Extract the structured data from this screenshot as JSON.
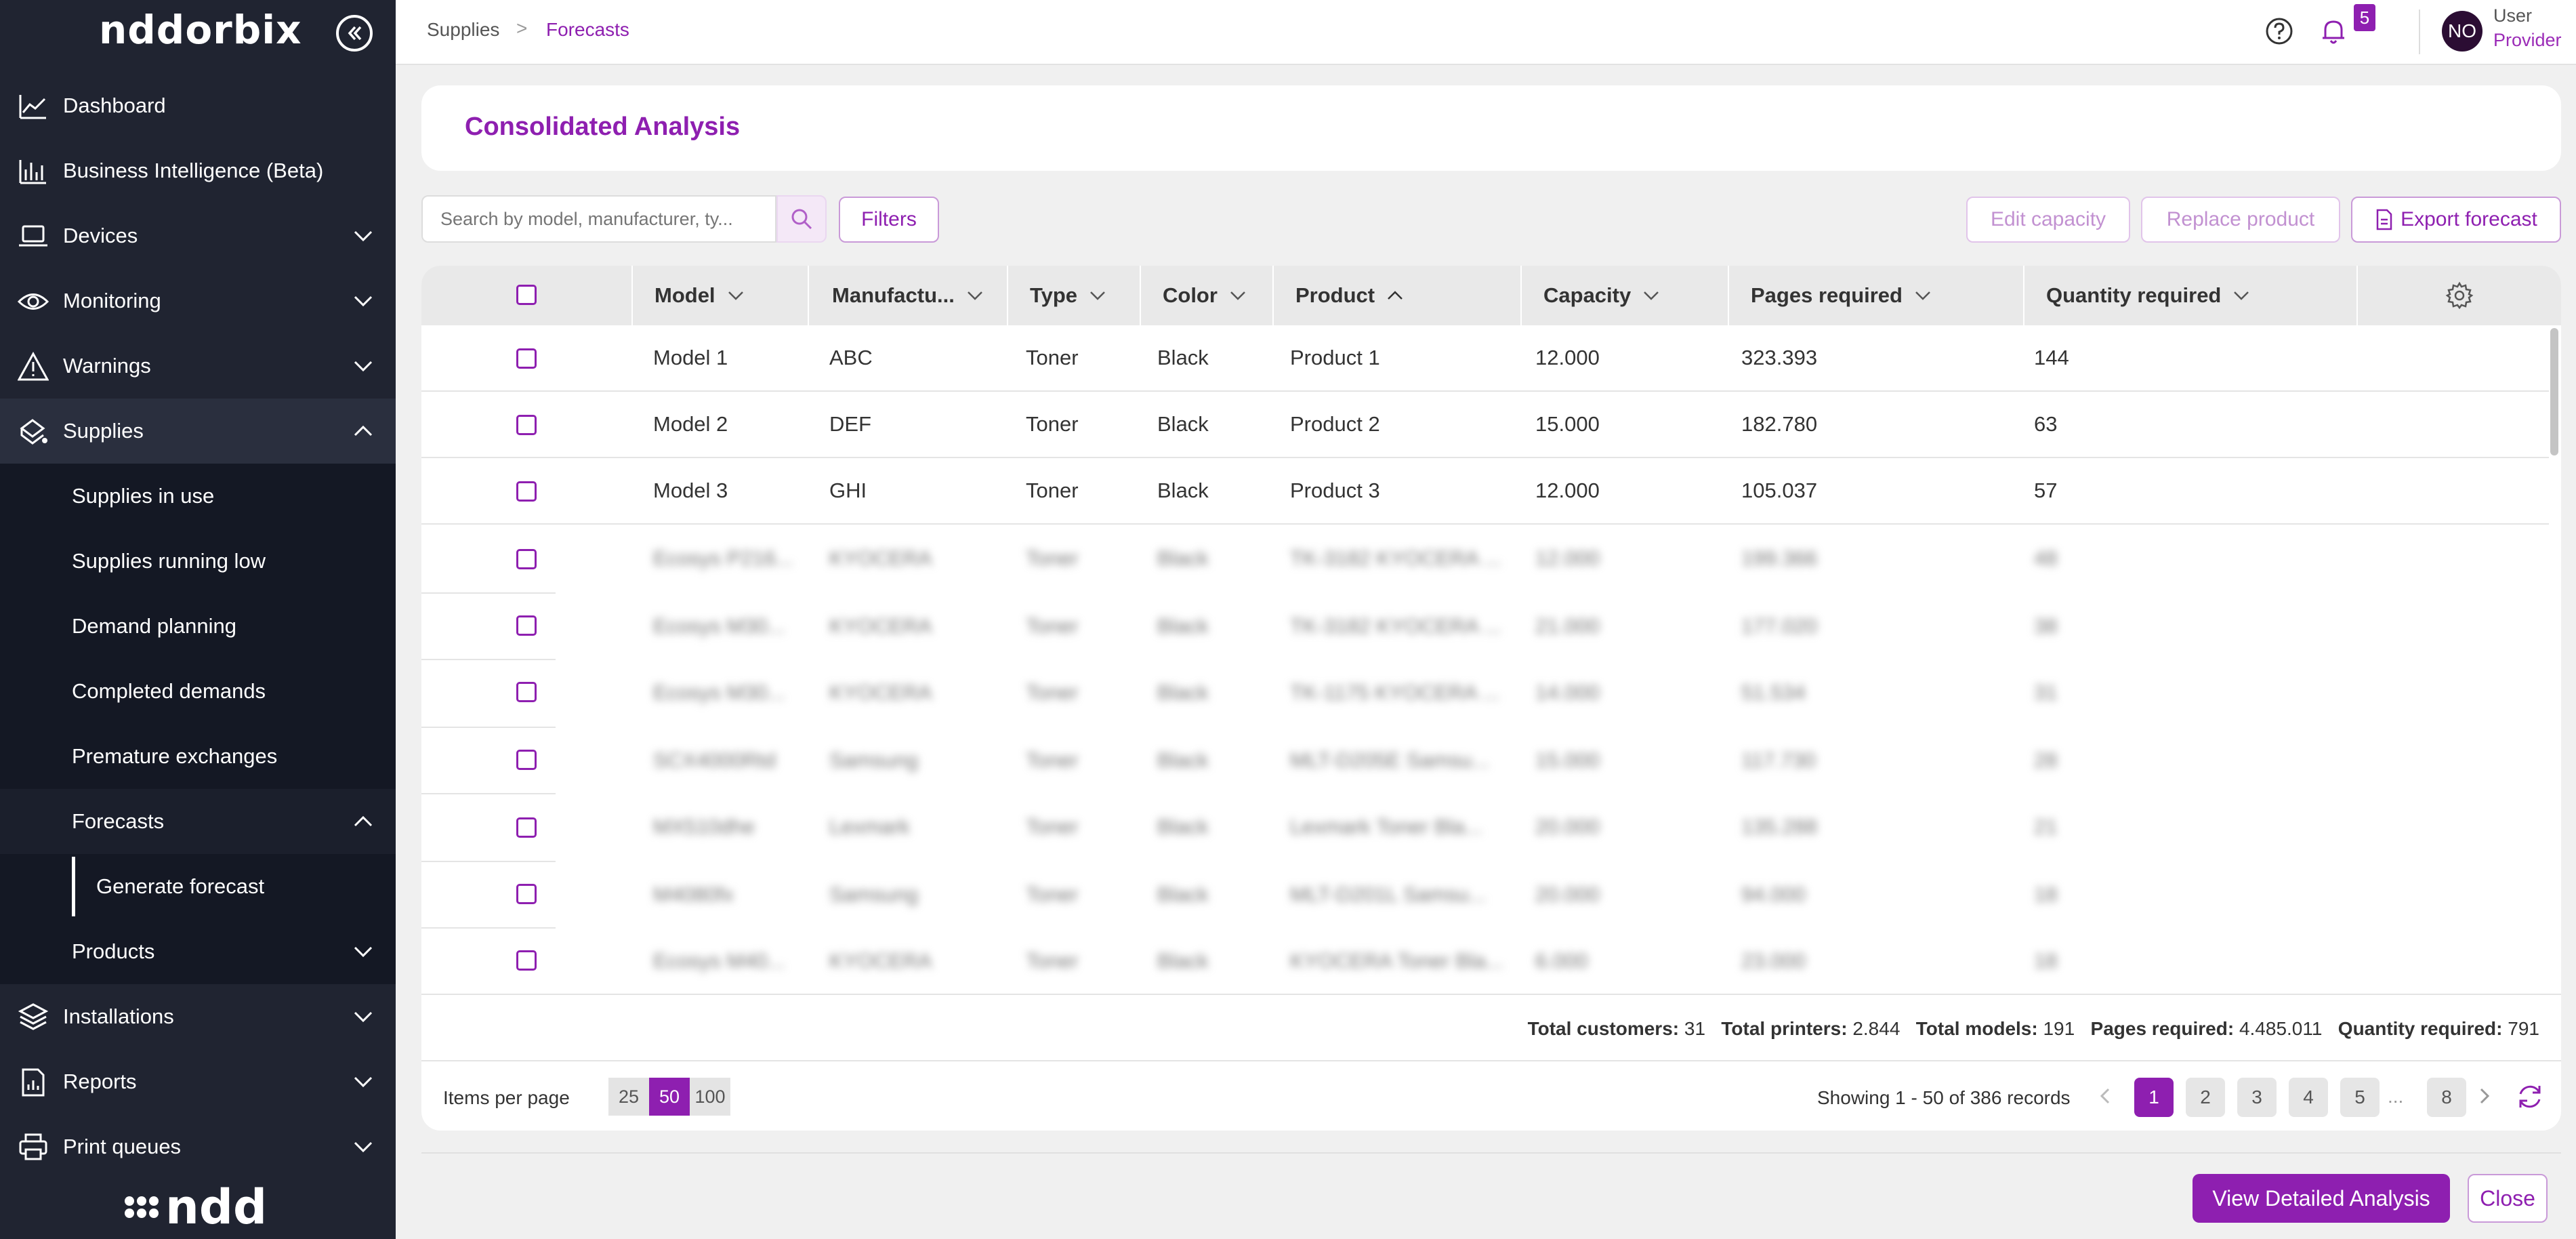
{
  "brand": {
    "logo": "nddorbix",
    "footer_logo": "ndd",
    "icon": "double-chevron-left-icon"
  },
  "sidebar": {
    "items": [
      {
        "label": "Dashboard",
        "icon": "trend-chart-icon"
      },
      {
        "label": "Business Intelligence (Beta)",
        "icon": "bar-chart-icon"
      },
      {
        "label": "Devices",
        "icon": "laptop-icon"
      },
      {
        "label": "Monitoring",
        "icon": "eye-icon"
      },
      {
        "label": "Warnings",
        "icon": "warning-icon"
      },
      {
        "label": "Supplies",
        "icon": "toner-icon"
      },
      {
        "label": "Installations",
        "icon": "layers-icon"
      },
      {
        "label": "Reports",
        "icon": "report-icon"
      },
      {
        "label": "Print queues",
        "icon": "printer-icon"
      }
    ],
    "supplies_sub": [
      {
        "label": "Supplies in use"
      },
      {
        "label": "Supplies running low"
      },
      {
        "label": "Demand planning"
      },
      {
        "label": "Completed demands"
      },
      {
        "label": "Premature exchanges"
      },
      {
        "label": "Forecasts"
      },
      {
        "label": "Products"
      }
    ],
    "forecasts_sub": [
      {
        "label": "Generate forecast"
      }
    ]
  },
  "header": {
    "breadcrumb": [
      "Supplies",
      "Forecasts"
    ],
    "breadcrumb_separator": ">",
    "notifications_count": "5",
    "avatar_initials": "NO",
    "user_name": "User",
    "user_role": "Provider"
  },
  "page": {
    "title": "Consolidated Analysis"
  },
  "toolbar": {
    "search_placeholder": "Search by model, manufacturer, ty...",
    "filters_label": "Filters",
    "edit_capacity_label": "Edit capacity",
    "replace_product_label": "Replace product",
    "export_forecast_label": "Export forecast"
  },
  "table": {
    "columns": [
      "Model",
      "Manufactu...",
      "Type",
      "Color",
      "Product",
      "Capacity",
      "Pages required",
      "Quantity required"
    ],
    "sorted_column": "Product",
    "rows": [
      [
        "Model 1",
        "ABC",
        "Toner",
        "Black",
        "Product 1",
        "12.000",
        "323.393",
        "144"
      ],
      [
        "Model 2",
        "DEF",
        "Toner",
        "Black",
        "Product 2",
        "15.000",
        "182.780",
        "63"
      ],
      [
        "Model 3",
        "GHI",
        "Toner",
        "Black",
        "Product 3",
        "12.000",
        "105.037",
        "57"
      ]
    ],
    "blurred_rows": [
      [
        "Ecosys P216...",
        "KYOCERA",
        "Toner",
        "Black",
        "TK-3182 KYOCERA ...",
        "12.000",
        "199.366",
        "48"
      ],
      [
        "Ecosys M30...",
        "KYOCERA",
        "Toner",
        "Black",
        "TK-3182 KYOCERA ...",
        "21.000",
        "177.020",
        "38"
      ],
      [
        "Ecosys M30...",
        "KYOCERA",
        "Toner",
        "Black",
        "TK-1175 KYOCERA ...",
        "14.000",
        "51.534",
        "31"
      ],
      [
        "SCX4000Rtd",
        "Samsung",
        "Toner",
        "Black",
        "MLT-D205E Samsu...",
        "15.000",
        "117.730",
        "28"
      ],
      [
        "MX510dhe",
        "Lexmark",
        "Toner",
        "Black",
        "Lexmark Toner Bla...",
        "20.000",
        "135.288",
        "21"
      ],
      [
        "M4080fx",
        "Samsung",
        "Toner",
        "Black",
        "MLT-D201L Samsu...",
        "20.000",
        "94.000",
        "18"
      ],
      [
        "Ecosys M40...",
        "KYOCERA",
        "Toner",
        "Black",
        "KYOCERA Toner Bla...",
        "6.000",
        "23.000",
        "18"
      ]
    ]
  },
  "totals": {
    "customers_label": "Total customers:",
    "customers": "31",
    "printers_label": "Total printers:",
    "printers": "2.844",
    "models_label": "Total models:",
    "models": "191",
    "pages_label": "Pages required:",
    "pages": "4.485.011",
    "quantity_label": "Quantity required:",
    "quantity": "791"
  },
  "pagination": {
    "items_per_page_label": "Items per page",
    "page_sizes": [
      "25",
      "50",
      "100"
    ],
    "active_page_size": "50",
    "showing_text": "Showing  1 - 50 of 386 records",
    "pages": [
      "1",
      "2",
      "3",
      "4",
      "5"
    ],
    "ellipsis": "...",
    "last_page": "8",
    "active_page": "1"
  },
  "footer": {
    "view_detailed_label": "View Detailed Analysis",
    "close_label": "Close"
  },
  "colors": {
    "accent": "#8e1fb0",
    "sidebar": "#202431",
    "sidebar_sub": "#141824"
  }
}
